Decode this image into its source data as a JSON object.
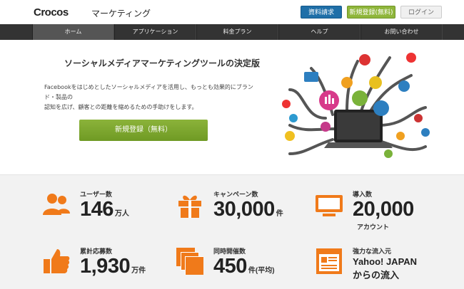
{
  "header": {
    "logo": "Crocos",
    "logo_sub": "マーケティング",
    "doc_button": "資料請求",
    "register_button": "新規登録(無料)",
    "login_button": "ログイン"
  },
  "nav": {
    "items": [
      "ホーム",
      "アプリケーション",
      "料金プラン",
      "ヘルプ",
      "お問い合わせ"
    ]
  },
  "hero": {
    "title": "ソーシャルメディアマーケティングツールの決定版",
    "description_line1": "Facebookをはじめとしたソーシャルメディアを活用し、もっとも効果的にブランド・製品の",
    "description_line2": "認知を広げ、顧客との距離を縮めるための手助けをします。",
    "cta": "新規登録（無料）"
  },
  "stats": {
    "users": {
      "label": "ユーザー数",
      "value": "146",
      "unit": "万人"
    },
    "campaigns": {
      "label": "キャンペーン数",
      "value": "30,000",
      "unit": "件"
    },
    "adoption": {
      "label": "導入数",
      "value": "20,000",
      "sub": "アカウント"
    },
    "entries": {
      "label": "累計応募数",
      "value": "1,930",
      "unit": "万件"
    },
    "concurrent": {
      "label": "同時開催数",
      "value": "450",
      "unit": "件(平均)"
    },
    "inflow": {
      "label": "強力な流入元",
      "line1": "Yahoo! JAPAN",
      "line2": "からの流入"
    }
  },
  "colors": {
    "accent": "#f07a1a",
    "nav_bg": "#333333",
    "cta": "#7aa42e",
    "doc_button": "#1f6fa8"
  }
}
